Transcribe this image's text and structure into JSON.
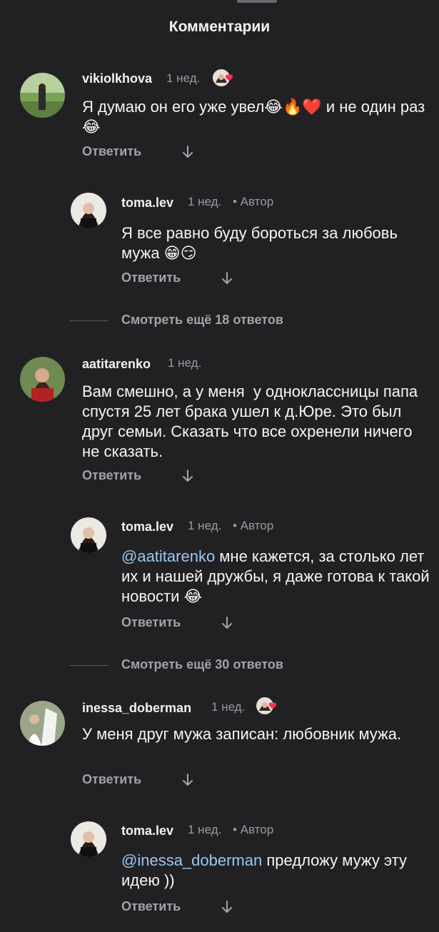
{
  "header": {
    "title": "Комментарии"
  },
  "comments": [
    {
      "username": "vikiolkhova",
      "time": "1 нед.",
      "text": "Я думаю он его уже увел😂🔥❤️ и не один раз 😂",
      "reply_label": "Ответить",
      "author_liked": true
    },
    {
      "username": "toma.lev",
      "time": "1 нед.",
      "author_badge": "• Автор",
      "text": "Я все равно буду бороться за любовь мужа 😁😏",
      "reply_label": "Ответить"
    },
    {
      "more_replies": "Смотреть ещё 18 ответов"
    },
    {
      "username": "aatitarenko",
      "time": "1 нед.",
      "text": "Вам смешно, а у меня  у одноклассницы папа спустя 25 лет брака ушел к д.Юре. Это был друг семьи. Сказать что все охренели ничего не сказать.",
      "reply_label": "Ответить"
    },
    {
      "username": "toma.lev",
      "time": "1 нед.",
      "author_badge": "• Автор",
      "mention": "@aatitarenko",
      "text": " мне кажется, за столько лет их и нашей дружбы, я даже готова к такой новости 😂",
      "reply_label": "Ответить"
    },
    {
      "more_replies": "Смотреть ещё 30 ответов"
    },
    {
      "username": "inessa_doberman",
      "time": "1 нед.",
      "text": "У меня друг мужа записан: любовник мужа.",
      "reply_label": "Ответить",
      "author_liked": true
    },
    {
      "username": "toma.lev",
      "time": "1 нед.",
      "author_badge": "• Автор",
      "mention": "@inessa_doberman",
      "text": " предложу мужу эту идею ))",
      "reply_label": "Ответить"
    }
  ],
  "colors": {
    "background": "#212124",
    "mention": "#9cc7ef",
    "like_heart": "#ff2d55",
    "muted_text": "#9a9aa0"
  },
  "icons": [
    "down-arrow-icon",
    "heart-icon"
  ]
}
